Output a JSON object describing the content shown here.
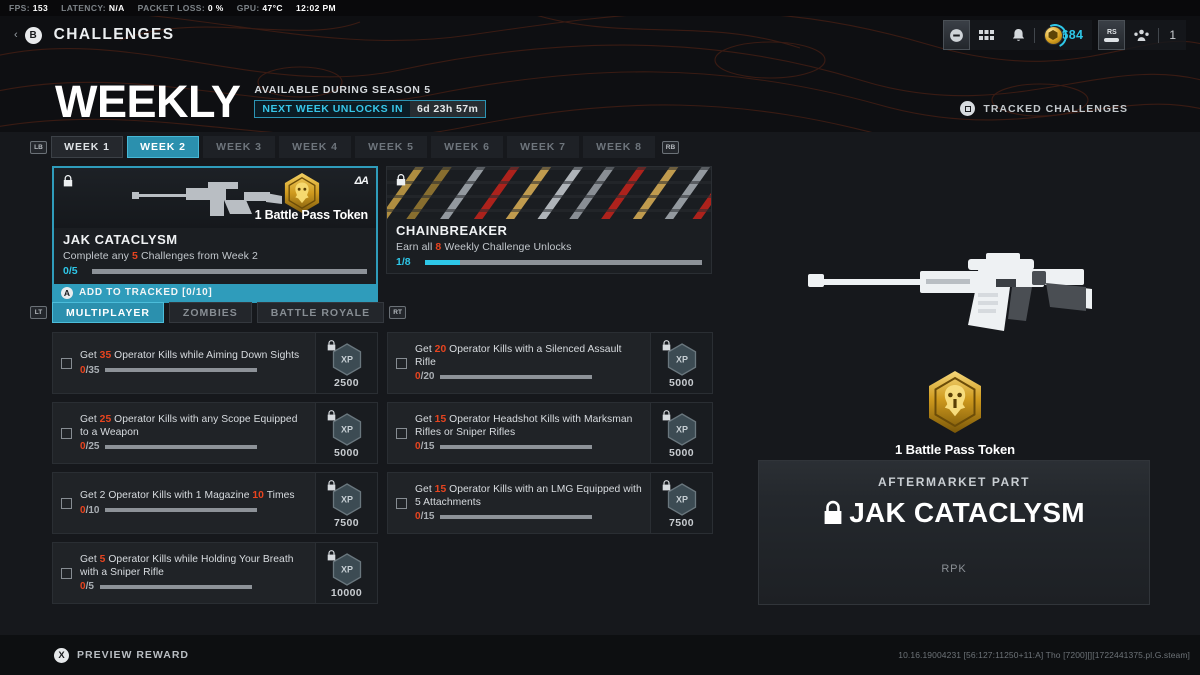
{
  "perf": {
    "fps_label": "FPS:",
    "fps_value": "153",
    "latency_label": "LATENCY:",
    "latency_value": "N/A",
    "packet_label": "PACKET LOSS:",
    "packet_value": "0 %",
    "gpu_label": "GPU:",
    "gpu_value": "47°C",
    "time": "12:02 PM"
  },
  "topnav": {
    "back_button": "B",
    "title": "CHALLENGES",
    "currency_value": "684",
    "rs_button": "RS",
    "party_count": "1"
  },
  "header": {
    "title": "WEEKLY",
    "available": "AVAILABLE DURING SEASON 5",
    "unlock_label": "NEXT WEEK UNLOCKS IN",
    "unlock_time": "6d 23h 57m",
    "tracked_label": "TRACKED CHALLENGES"
  },
  "week_tabs": {
    "left_bumper": "LB",
    "right_bumper": "RB",
    "items": [
      {
        "label": "WEEK 1",
        "state": "done"
      },
      {
        "label": "WEEK 2",
        "state": "active"
      },
      {
        "label": "WEEK 3",
        "state": "locked"
      },
      {
        "label": "WEEK 4",
        "state": "locked"
      },
      {
        "label": "WEEK 5",
        "state": "locked"
      },
      {
        "label": "WEEK 6",
        "state": "locked"
      },
      {
        "label": "WEEK 7",
        "state": "locked"
      },
      {
        "label": "WEEK 8",
        "state": "locked"
      }
    ]
  },
  "reward_cards": [
    {
      "name": "JAK CATACLYSM",
      "description_pre": "Complete any ",
      "description_num": "5",
      "description_post": " Challenges from Week 2",
      "progress_text": "0/5",
      "progress_pct": 0,
      "token_label": "1 Battle Pass Token",
      "footer_button": "A",
      "footer_label": "ADD TO TRACKED [0/10]"
    },
    {
      "name": "CHAINBREAKER",
      "description_pre": "Earn all ",
      "description_num": "8",
      "description_post": " Weekly Challenge Unlocks",
      "progress_text": "1/8",
      "progress_pct": 12.5
    }
  ],
  "mode_tabs": {
    "left_trigger": "LT",
    "right_trigger": "RT",
    "items": [
      {
        "label": "MULTIPLAYER",
        "state": "active"
      },
      {
        "label": "ZOMBIES",
        "state": "inactive"
      },
      {
        "label": "BATTLE ROYALE",
        "state": "inactive"
      }
    ]
  },
  "challenges": [
    {
      "text_pre": "Get ",
      "text_num": "35",
      "text_post": " Operator Kills while Aiming Down Sights",
      "current": "0",
      "goal": "/35",
      "progress_pct": 0,
      "xp": "2500"
    },
    {
      "text_pre": "Get ",
      "text_num": "20",
      "text_post": " Operator Kills with a Silenced Assault Rifle",
      "current": "0",
      "goal": "/20",
      "progress_pct": 0,
      "xp": "5000"
    },
    {
      "text_pre": "Get ",
      "text_num": "25",
      "text_post": " Operator Kills with any Scope Equipped to a Weapon",
      "current": "0",
      "goal": "/25",
      "progress_pct": 0,
      "xp": "5000"
    },
    {
      "text_pre": "Get ",
      "text_num": "15",
      "text_post": " Operator Headshot Kills with Marksman Rifles or Sniper Rifles",
      "current": "0",
      "goal": "/15",
      "progress_pct": 0,
      "xp": "5000"
    },
    {
      "text_pre": "Get 2 Operator Kills with 1 Magazine ",
      "text_num": "10",
      "text_post": " Times",
      "current": "0",
      "goal": "/10",
      "progress_pct": 0,
      "xp": "7500"
    },
    {
      "text_pre": "Get ",
      "text_num": "15",
      "text_post": " Operator Kills with an LMG Equipped with 5 Attachments",
      "current": "0",
      "goal": "/15",
      "progress_pct": 0,
      "xp": "7500"
    },
    {
      "text_pre": "Get ",
      "text_num": "5",
      "text_post": " Operator Kills while Holding Your Breath with a Sniper Rifle",
      "current": "0",
      "goal": "/5",
      "progress_pct": 0,
      "xp": "10000"
    }
  ],
  "preview": {
    "token_caption": "1 Battle Pass Token",
    "reward_type": "AFTERMARKET PART",
    "reward_name": "JAK CATACLYSM",
    "weapon": "RPK"
  },
  "footer": {
    "preview_button": "X",
    "preview_label": "PREVIEW REWARD",
    "build": "10.16.19004231 [56:127:11250+11:A] Tho [7200][][1722441375.pl.G.steam]"
  },
  "colors": {
    "accent_teal": "#2ec7e8",
    "accent_tab": "#2b90ae",
    "accent_orange": "#e8441f",
    "gold": "#d8a11f",
    "background": "#16181c"
  }
}
